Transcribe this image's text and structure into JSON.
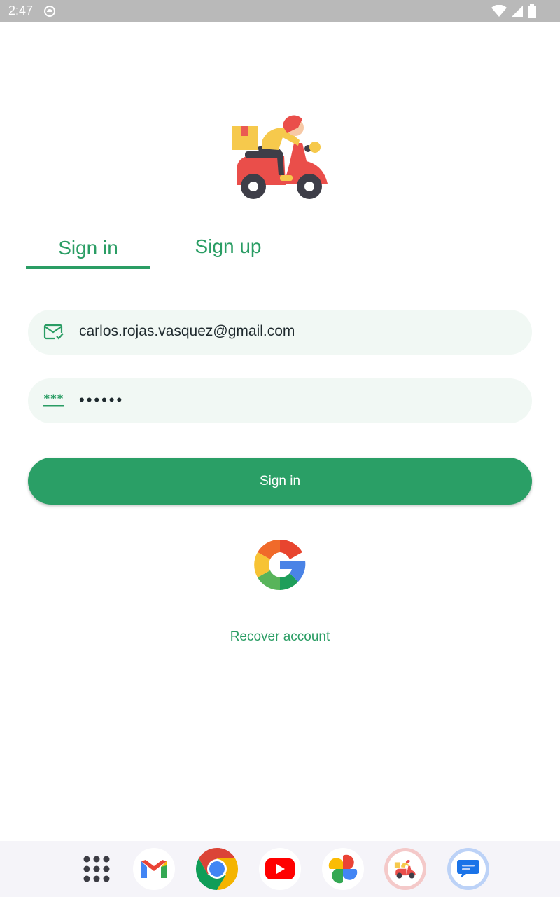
{
  "status_bar": {
    "time": "2:47"
  },
  "auth": {
    "tabs": [
      {
        "label": "Sign in",
        "active": true
      },
      {
        "label": "Sign up",
        "active": false
      }
    ],
    "email": {
      "value": "carlos.rojas.vasquez@gmail.com",
      "icon": "mail-check-icon"
    },
    "password": {
      "value": "••••••",
      "icon": "password-icon"
    },
    "signin_button": "Sign in",
    "google_icon": "google-icon",
    "recover_link": "Recover account"
  },
  "dock": {
    "apps": [
      "app-drawer",
      "gmail",
      "chrome",
      "youtube",
      "photos",
      "delivery-app",
      "messages"
    ]
  },
  "colors": {
    "accent": "#2a9f66",
    "field_bg": "#f1f8f4",
    "status_bar": "#b9b9b9"
  }
}
